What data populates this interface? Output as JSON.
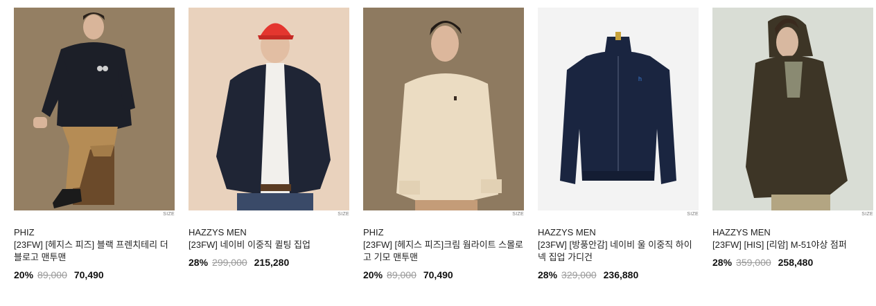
{
  "products": [
    {
      "brand": "PHIZ",
      "name": "[23FW] [헤지스 피즈] 블랙 프렌치테리 더블로고 맨투맨",
      "discount": "20%",
      "original_price": "89,000",
      "sale_price": "70,490",
      "size_label": "SIZE",
      "bg": "#8f7a5f",
      "garment": "#1c1f28"
    },
    {
      "brand": "HAZZYS MEN",
      "name": "[23FW] 네이비 이중직 퀼팅 집업",
      "discount": "28%",
      "original_price": "299,000",
      "sale_price": "215,280",
      "size_label": "SIZE",
      "bg": "#e9d2bd",
      "garment": "#1f2535"
    },
    {
      "brand": "PHIZ",
      "name": "[23FW] [헤지스 피즈]크림 웜라이트 스몰로고 기모 맨투맨",
      "discount": "20%",
      "original_price": "89,000",
      "sale_price": "70,490",
      "size_label": "SIZE",
      "bg": "#8e7a60",
      "garment": "#ebdcc2"
    },
    {
      "brand": "HAZZYS MEN",
      "name": "[23FW] [방풍안감] 네이비 울 이중직 하이넥 집업 가디건",
      "discount": "28%",
      "original_price": "329,000",
      "sale_price": "236,880",
      "size_label": "SIZE",
      "bg": "#f3f3f3",
      "garment": "#1a2540"
    },
    {
      "brand": "HAZZYS MEN",
      "name": "[23FW] [HIS] [리암] M-51야상 점퍼",
      "discount": "28%",
      "original_price": "359,000",
      "sale_price": "258,480",
      "size_label": "SIZE",
      "bg": "#d9ddd5",
      "garment": "#3d3526"
    }
  ]
}
